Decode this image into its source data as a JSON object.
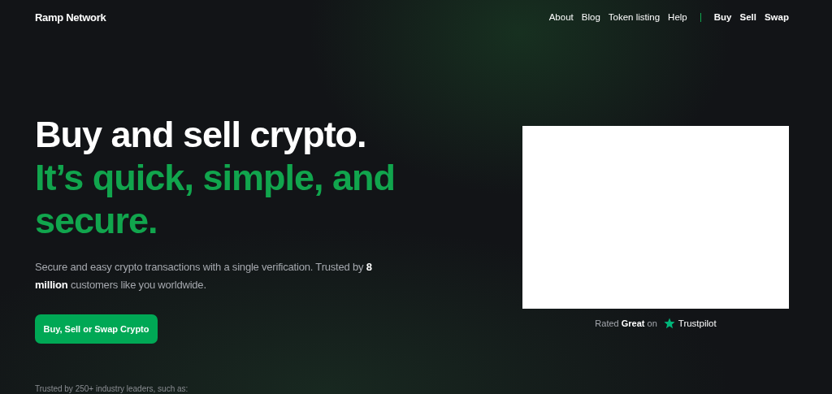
{
  "header": {
    "logo": "Ramp Network",
    "nav": [
      {
        "label": "About",
        "kind": "link"
      },
      {
        "label": "Blog",
        "kind": "link"
      },
      {
        "label": "Token listing",
        "kind": "link"
      },
      {
        "label": "Help",
        "kind": "link"
      },
      {
        "label": "Buy",
        "kind": "action"
      },
      {
        "label": "Sell",
        "kind": "action"
      },
      {
        "label": "Swap",
        "kind": "action"
      }
    ]
  },
  "hero": {
    "headline": "Buy and sell crypto.",
    "headline_accent": "It’s quick, simple, and secure.",
    "description": "Secure and easy crypto transactions with a single verification. Trusted by **8 million** customers like you worldwide.",
    "cta": "Buy, Sell or Swap Crypto",
    "trusted": "Trusted by 250+ industry leaders, such as:"
  },
  "widget": {
    "rating": "Rated **Great** on",
    "brand": "Trustpilot"
  }
}
